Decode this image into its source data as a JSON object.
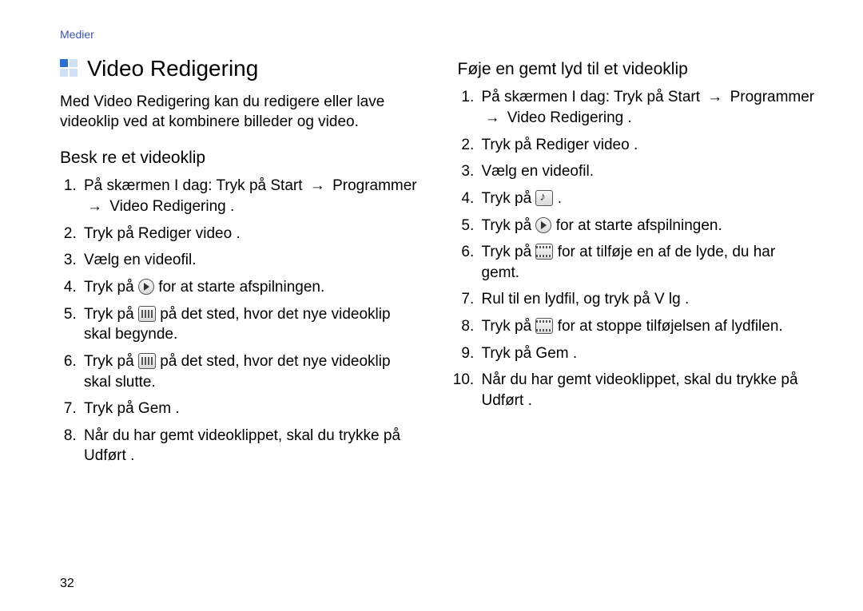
{
  "header": {
    "breadcrumb": "Medier"
  },
  "page_number": "32",
  "left": {
    "title": "Video Redigering",
    "intro": "Med Video Redigering kan du redigere eller lave videoklip ved at kombinere billeder og video.",
    "subhead": "Besk re et videoklip",
    "steps": {
      "s1_pre": "På skærmen I dag: Tryk på ",
      "s1_a": "Start",
      "s1_arrow1": "→",
      "s1_b": "Programmer",
      "s1_arrow2": "→",
      "s1_c": "Video Redigering",
      "s1_post": ".",
      "s2_pre": "Tryk på ",
      "s2_a": "Rediger video",
      "s2_post": ".",
      "s3": "Vælg en videofil.",
      "s4_pre": "Tryk på ",
      "s4_post": " for at starte afspilningen.",
      "s5_pre": "Tryk på ",
      "s5_post": " på det sted, hvor det nye videoklip skal begynde.",
      "s6_pre": "Tryk på ",
      "s6_post": " på det sted, hvor det nye videoklip skal slutte.",
      "s7_pre": "Tryk på ",
      "s7_a": "Gem",
      "s7_post": ".",
      "s8_pre": "Når du har gemt videoklippet, skal du trykke på ",
      "s8_a": "Udført",
      "s8_post": "."
    }
  },
  "right": {
    "subhead": "Føje en gemt lyd til et videoklip",
    "steps": {
      "s1_pre": "På skærmen I dag: Tryk på ",
      "s1_a": "Start",
      "s1_arrow1": "→",
      "s1_b": "Programmer",
      "s1_arrow2": "→",
      "s1_c": "Video Redigering",
      "s1_post": ".",
      "s2_pre": "Tryk på ",
      "s2_a": "Rediger video",
      "s2_post": ".",
      "s3": "Vælg en videofil.",
      "s4_pre": "Tryk på ",
      "s4_post": ".",
      "s5_pre": "Tryk på ",
      "s5_post": " for at starte afspilningen.",
      "s6_pre": "Tryk på ",
      "s6_post": " for at tilføje en af de lyde, du har gemt.",
      "s7_pre": "Rul til en lydfil, og tryk på ",
      "s7_a": "V lg",
      "s7_post": ".",
      "s8_pre": "Tryk på ",
      "s8_post": " for at stoppe tilføjelsen af lydfilen.",
      "s9_pre": "Tryk på ",
      "s9_a": "Gem",
      "s9_post": ".",
      "s10_pre": "Når du har gemt videoklippet, skal du trykke på ",
      "s10_a": "Udført",
      "s10_post": "."
    }
  }
}
